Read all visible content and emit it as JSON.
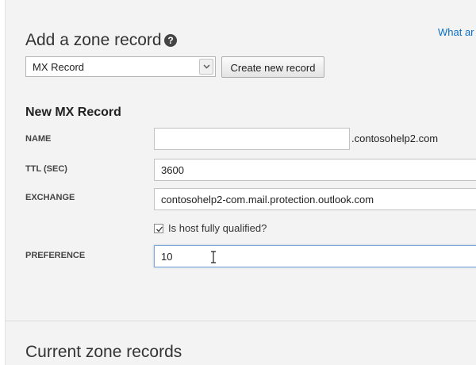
{
  "header": {
    "title": "Add a zone record",
    "help_icon": "question-circle-icon",
    "help_link": "What ar"
  },
  "record_type_select": {
    "value": "MX Record",
    "icon": "chevron-down-icon"
  },
  "create_button_label": "Create new record",
  "form": {
    "section_title": "New MX Record",
    "name": {
      "label": "NAME",
      "value": "",
      "suffix": ".contosohelp2.com"
    },
    "ttl": {
      "label": "TTL (SEC)",
      "value": "3600"
    },
    "exchange": {
      "label": "EXCHANGE",
      "value": "contosohelp2-com.mail.protection.outlook.com"
    },
    "host_checkbox": {
      "label": "Is host fully qualified?",
      "checked": true
    },
    "preference": {
      "label": "PREFERENCE",
      "value": "10"
    }
  },
  "current_records_title": "Current zone records",
  "colors": {
    "link": "#0b6fc4",
    "focus_border": "#7ea7d8",
    "panel_bg": "#f3f3f3"
  }
}
